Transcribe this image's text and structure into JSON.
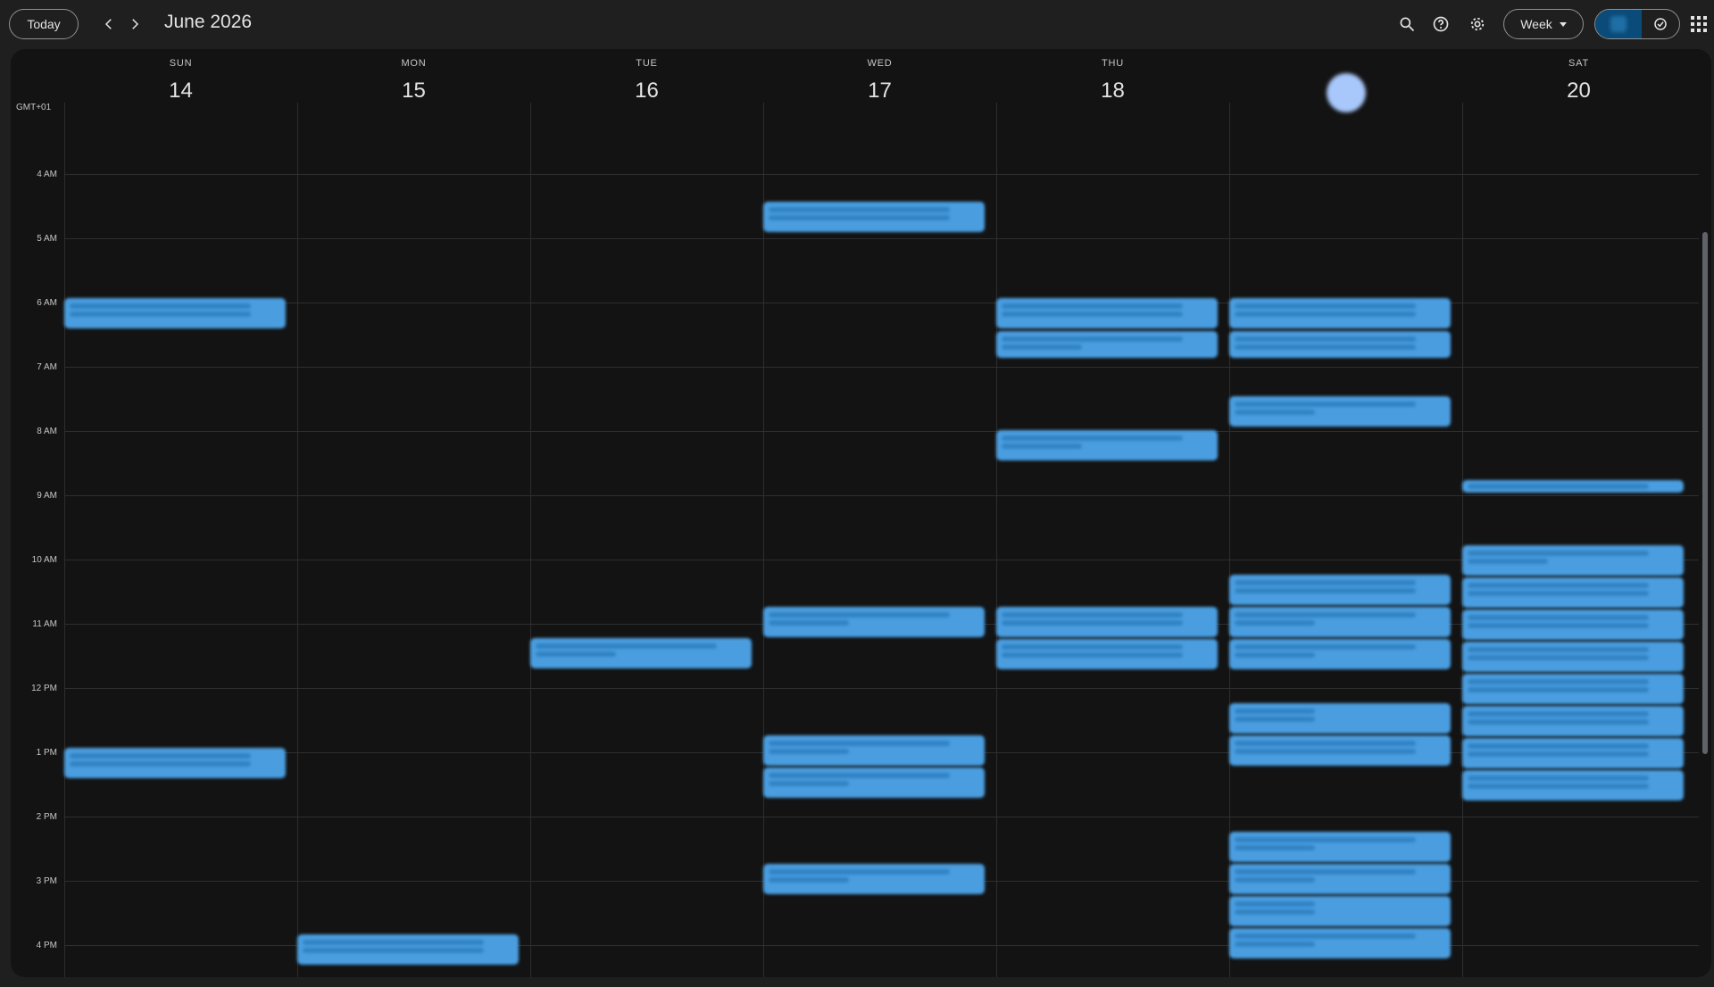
{
  "header": {
    "today_label": "Today",
    "month_title": "June 2026",
    "view_label": "Week"
  },
  "timezone": "GMT+01",
  "days": [
    {
      "abbr": "SUN",
      "num": "14"
    },
    {
      "abbr": "MON",
      "num": "15"
    },
    {
      "abbr": "TUE",
      "num": "16"
    },
    {
      "abbr": "WED",
      "num": "17"
    },
    {
      "abbr": "THU",
      "num": "18"
    },
    {
      "abbr": "",
      "num": "",
      "is_today": true
    },
    {
      "abbr": "SAT",
      "num": "20"
    }
  ],
  "hours": [
    "4 AM",
    "5 AM",
    "6 AM",
    "7 AM",
    "8 AM",
    "9 AM",
    "10 AM",
    "11 AM",
    "12 PM",
    "1 PM",
    "2 PM",
    "3 PM",
    "4 PM"
  ],
  "colors": {
    "event": "#4a9ee0",
    "background": "#131313",
    "today_circle": "#a8c7fa"
  },
  "icons": [
    "chevron-left-icon",
    "chevron-right-icon",
    "search-icon",
    "help-icon",
    "gear-icon",
    "calendar-icon",
    "task-check-icon",
    "apps-grid-icon"
  ]
}
